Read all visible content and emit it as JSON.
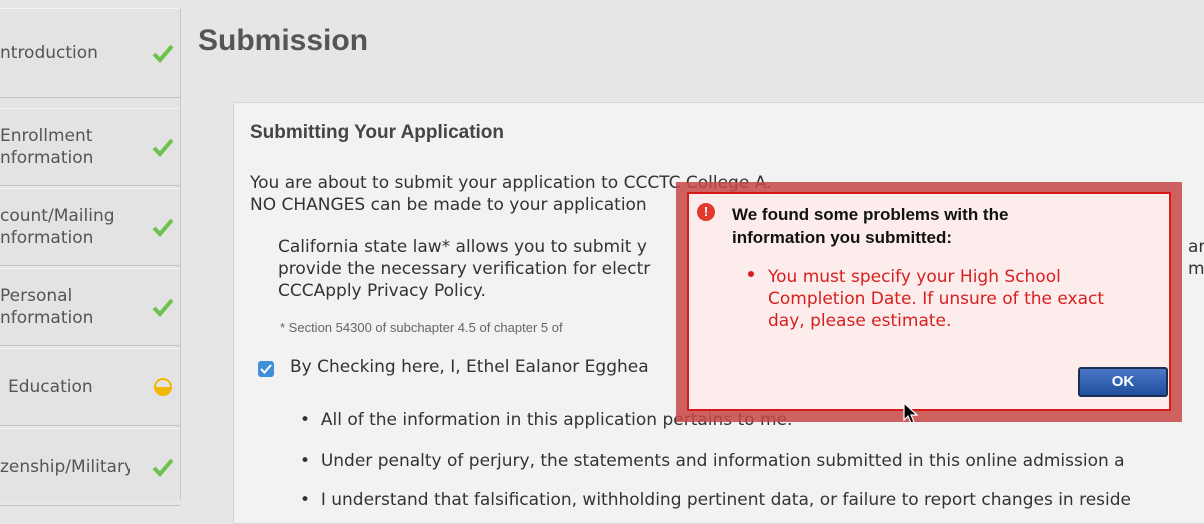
{
  "sidebar": {
    "items": [
      {
        "label": "ntroduction",
        "status": "complete",
        "icon": "check-icon"
      },
      {
        "label": "Enrollment\nnformation",
        "status": "complete",
        "icon": "check-icon"
      },
      {
        "label": "count/Mailing\nnformation",
        "status": "complete",
        "icon": "check-icon"
      },
      {
        "label": "Personal\nnformation",
        "status": "complete",
        "icon": "check-icon"
      },
      {
        "label": "Education",
        "status": "in-progress",
        "icon": "half-circle-icon"
      },
      {
        "label": "zenship/Military",
        "status": "complete",
        "icon": "check-icon"
      }
    ]
  },
  "page": {
    "title": "Submission"
  },
  "card": {
    "title": "Submitting Your Application",
    "p1": "You are about to submit your application to CCCTC College A.\nNO CHANGES can be made to your application",
    "p2": "California state law* allows you to submit y\nprovide the necessary verification for electr\nCCCApply Privacy Policy.",
    "p2_right": "ar\nma",
    "footnote": "* Section 54300 of subchapter 4.5 of chapter 5 of",
    "checkbox_text": "By Checking here, I, Ethel Ealanor Egghea",
    "bullets": [
      "All of the information in this application pertains to me.",
      "Under penalty of perjury, the statements and information submitted in this online admission a",
      "I understand that falsification, withholding pertinent data, or failure to report changes in reside"
    ]
  },
  "dialog": {
    "heading": "We found some problems with the\ninformation you submitted:",
    "message": "You must specify your High School\nCompletion Date. If unsure of the exact\nday, please estimate.",
    "ok_label": "OK"
  },
  "colors": {
    "check": "#6cc24a",
    "error": "#d71f1f",
    "warning": "#f2b705",
    "button": "#2b5aa8"
  }
}
